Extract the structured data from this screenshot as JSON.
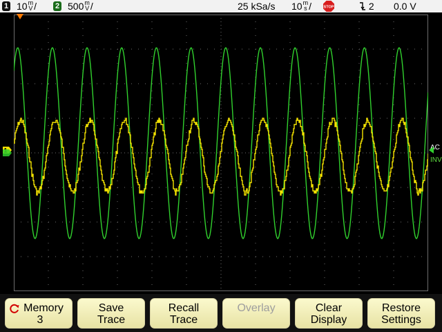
{
  "status_bar": {
    "ch1": {
      "number": "1",
      "scale": "10",
      "unit_top": "m",
      "unit_bottom": "V",
      "slash": "/",
      "color": "#f5e000"
    },
    "ch2": {
      "number": "2",
      "scale": "500",
      "unit_top": "m",
      "unit_bottom": "V",
      "slash": "/",
      "color": "#3cb83c"
    },
    "sample_rate": "25 kSa/s",
    "timebase": {
      "scale": "10",
      "unit_top": "m",
      "unit_bottom": "s",
      "slash": "/"
    },
    "run_state": "STOP",
    "run_state_icon": "stop-sign-icon",
    "trigger": {
      "icon": "falling-edge-icon",
      "source": "2"
    },
    "trigger_level": "0.0 V"
  },
  "display": {
    "side_labels": {
      "coupling": "AC",
      "inverted": "INV"
    },
    "colors": {
      "ch1_trace": "#f5e400",
      "ch2_trace": "#31d22e",
      "grid": "#6f6f6f",
      "background": "#000000"
    },
    "ch1_trace_label": "1",
    "ch2_trace_label": "2"
  },
  "softkeys": [
    {
      "line1": "Memory",
      "line2": "3",
      "icon": "rotate-knob-icon",
      "enabled": true
    },
    {
      "line1": "Save",
      "line2": "Trace",
      "enabled": true
    },
    {
      "line1": "Recall",
      "line2": "Trace",
      "enabled": true
    },
    {
      "line1": "Overlay",
      "line2": "",
      "enabled": false
    },
    {
      "line1": "Clear",
      "line2": "Display",
      "enabled": true
    },
    {
      "line1": "Restore",
      "line2": "Settings",
      "enabled": true
    }
  ]
}
